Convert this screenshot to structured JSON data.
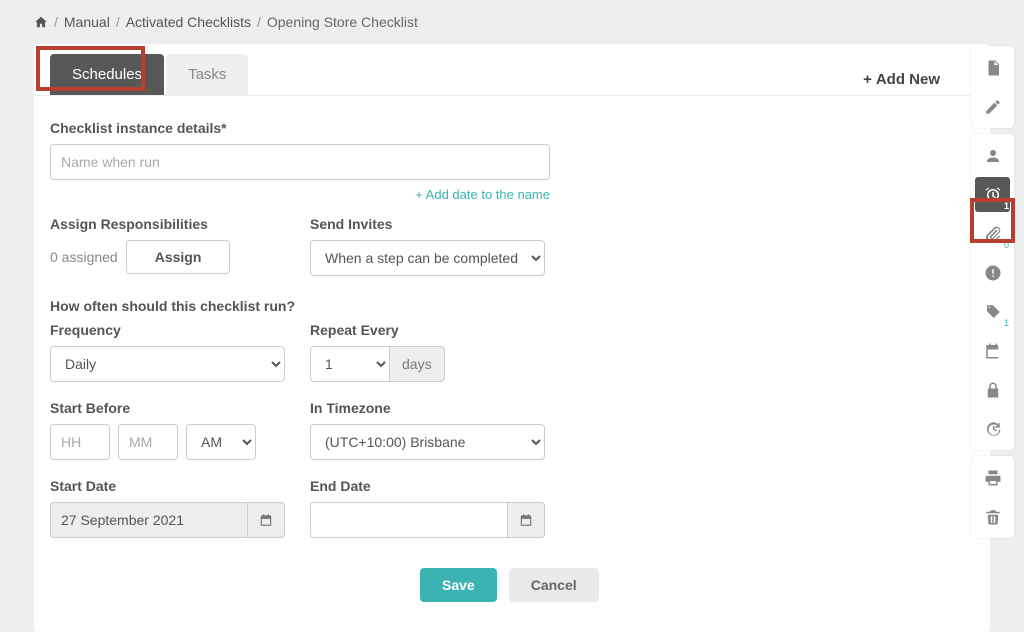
{
  "breadcrumb": {
    "manual": "Manual",
    "activated": "Activated Checklists",
    "opening": "Opening Store Checklist"
  },
  "tabs": {
    "schedules": "Schedules",
    "tasks": "Tasks"
  },
  "addNew": "Add New",
  "form": {
    "detailsLabel": "Checklist instance details*",
    "detailsPlaceholder": "Name when run",
    "addDateLink": "+ Add date to the name",
    "assignLabel": "Assign Responsibilities",
    "assignedCount": "0 assigned",
    "assignBtn": "Assign",
    "sendInvitesLabel": "Send Invites",
    "sendInvitesValue": "When a step can be completed",
    "howOftenLabel": "How often should this checklist run?",
    "frequencyLabel": "Frequency",
    "frequencyValue": "Daily",
    "repeatEveryLabel": "Repeat Every",
    "repeatEveryValue": "1",
    "daysLabel": "days",
    "startBeforeLabel": "Start Before",
    "hhPlaceholder": "HH",
    "mmPlaceholder": "MM",
    "ampmValue": "AM",
    "timezoneLabel": "In Timezone",
    "timezoneValue": "(UTC+10:00) Brisbane",
    "startDateLabel": "Start Date",
    "startDateValue": "27 September 2021",
    "endDateLabel": "End Date",
    "endDateValue": "",
    "saveBtn": "Save",
    "cancelBtn": "Cancel"
  },
  "railBadges": {
    "alarm": "1",
    "attach": "0",
    "tag": "1"
  }
}
